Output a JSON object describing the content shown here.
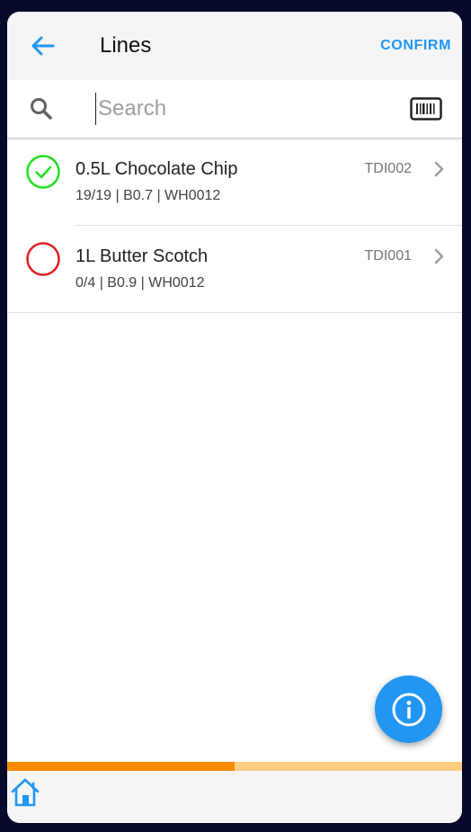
{
  "appbar": {
    "title": "Lines",
    "confirm_label": "CONFIRM"
  },
  "search": {
    "placeholder": "Search",
    "value": ""
  },
  "icons": {
    "back": "arrow-left-icon",
    "search": "search-icon",
    "barcode": "barcode-scan-icon",
    "chevron": "chevron-right-icon",
    "info": "info-icon",
    "home": "home-icon"
  },
  "colors": {
    "accent": "#2196f3",
    "complete": "#1ee11e",
    "incomplete": "#e02020",
    "progress_fill": "#fb8c00",
    "progress_track": "#ffcc80"
  },
  "lines": [
    {
      "name": "0.5L Chocolate Chip",
      "details": "19/19 | B0.7 | WH0012",
      "code": "TDI002",
      "status": "complete"
    },
    {
      "name": "1L Butter Scotch",
      "details": "0/4 | B0.9 | WH0012",
      "code": "TDI001",
      "status": "incomplete"
    }
  ],
  "progress": 0.5
}
